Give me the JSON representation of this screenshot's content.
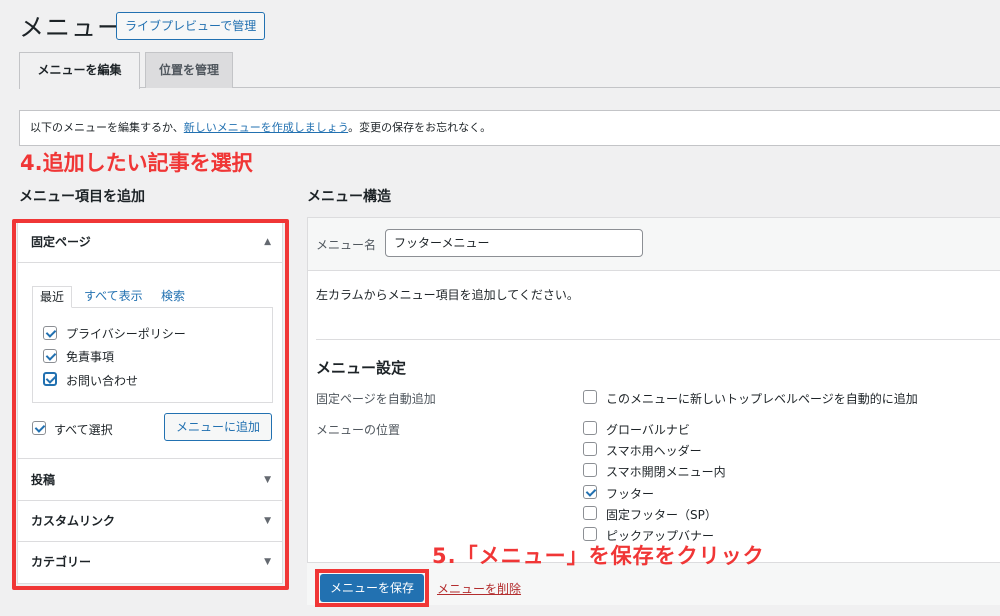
{
  "header": {
    "title": "メニュー",
    "live_preview_button": "ライブプレビューで管理"
  },
  "tabs": [
    {
      "label": "メニューを編集",
      "active": true
    },
    {
      "label": "位置を管理",
      "active": false
    }
  ],
  "notice": {
    "text_before": "以下のメニューを編集するか、",
    "link": "新しいメニューを作成しましょう",
    "text_after": "。変更の保存をお忘れなく。"
  },
  "annotations": {
    "step4": "4.追加したい記事を選択",
    "step5": "5.「メニュー」を保存をクリック",
    "color": "#f03636"
  },
  "left": {
    "heading": "メニュー項目を追加",
    "accordion": [
      {
        "label": "固定ページ",
        "expanded": true,
        "arrow": "▲"
      },
      {
        "label": "投稿",
        "expanded": false,
        "arrow": "▼"
      },
      {
        "label": "カスタムリンク",
        "expanded": false,
        "arrow": "▼"
      },
      {
        "label": "カテゴリー",
        "expanded": false,
        "arrow": "▼"
      }
    ],
    "inner_tabs": [
      "最近",
      "すべて表示",
      "検索"
    ],
    "pages": [
      {
        "label": "プライバシーポリシー",
        "checked": true
      },
      {
        "label": "免責事項",
        "checked": true
      },
      {
        "label": "お問い合わせ",
        "checked": true
      }
    ],
    "select_all": {
      "label": "すべて選択",
      "checked": true
    },
    "add_button": "メニューに追加"
  },
  "right": {
    "heading": "メニュー構造",
    "menu_name_label": "メニュー名",
    "menu_name_value": "フッターメニュー",
    "instructions": "左カラムからメニュー項目を追加してください。",
    "settings_title": "メニュー設定",
    "auto_add_label": "固定ページを自動追加",
    "auto_add_option": {
      "label": "このメニューに新しいトップレベルページを自動的に追加",
      "checked": false
    },
    "location_label": "メニューの位置",
    "locations": [
      {
        "label": "グローバルナビ",
        "checked": false
      },
      {
        "label": "スマホ用ヘッダー",
        "checked": false
      },
      {
        "label": "スマホ開閉メニュー内",
        "checked": false
      },
      {
        "label": "フッター",
        "checked": true
      },
      {
        "label": "固定フッター（SP）",
        "checked": false
      },
      {
        "label": "ピックアップバナー",
        "checked": false
      }
    ],
    "save_button": "メニューを保存",
    "delete_link": "メニューを削除"
  },
  "colors": {
    "accent": "#2271b1",
    "delete": "#b32d2e",
    "background": "#f0f0f1"
  }
}
